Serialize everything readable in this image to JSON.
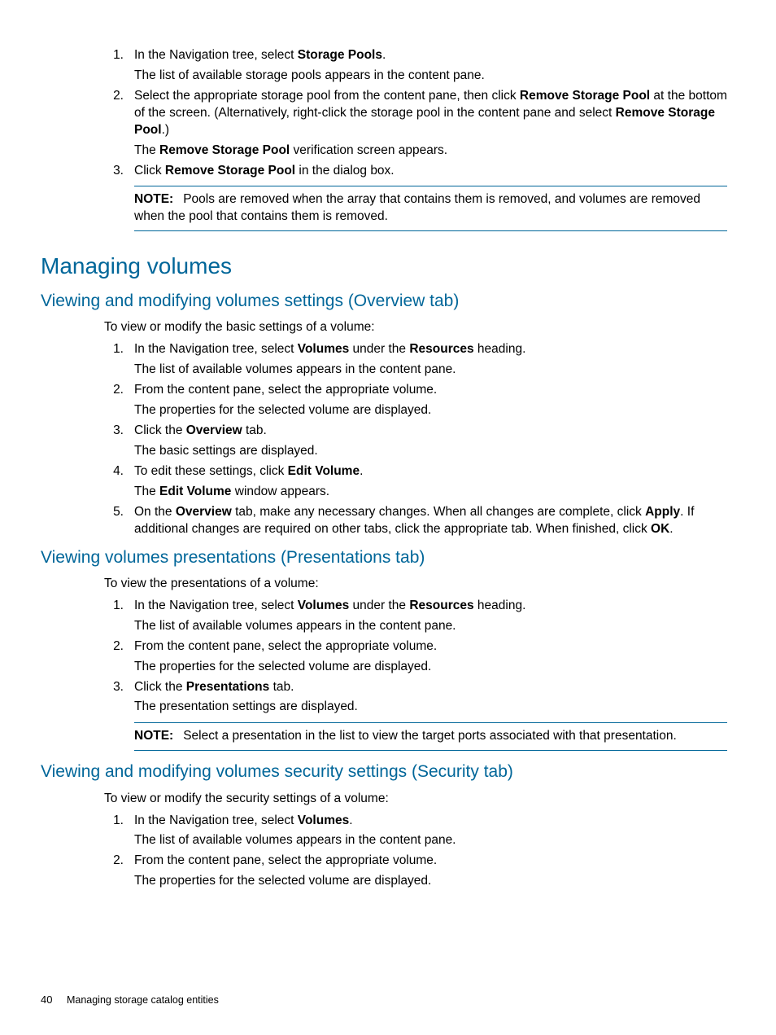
{
  "topList": {
    "items": [
      {
        "num": "1.",
        "line": "In the Navigation tree, select ",
        "bold1": "Storage Pools",
        "after1": ".",
        "result": "The list of available storage pools appears in the content pane."
      },
      {
        "num": "2.",
        "line": "Select the appropriate storage pool from the content pane, then click ",
        "bold1": "Remove Storage Pool",
        "after1": " at the bottom of the screen. (Alternatively, right-click the storage pool in the content pane and select ",
        "bold2": "Remove Storage Pool",
        "after2": ".)",
        "resultPre": "The ",
        "resultBold": "Remove Storage Pool",
        "resultPost": " verification screen appears."
      },
      {
        "num": "3.",
        "line": "Click ",
        "bold1": "Remove Storage Pool",
        "after1": " in the dialog box."
      }
    ],
    "note": {
      "label": "NOTE:",
      "text": "Pools are removed when the array that contains them is removed, and volumes are removed when the pool that contains them is removed."
    }
  },
  "h1": "Managing volumes",
  "sections": [
    {
      "heading": "Viewing and modifying volumes settings (Overview tab)",
      "intro": "To view or modify the basic settings of a volume:",
      "items": [
        {
          "num": "1.",
          "line": "In the Navigation tree, select ",
          "bold1": "Volumes",
          "after1": " under the ",
          "bold2": "Resources",
          "after2": " heading.",
          "result": "The list of available volumes appears in the content pane."
        },
        {
          "num": "2.",
          "line": "From the content pane, select the appropriate volume.",
          "result": "The properties for the selected volume are displayed."
        },
        {
          "num": "3.",
          "line": "Click the ",
          "bold1": "Overview",
          "after1": " tab.",
          "result": "The basic settings are displayed."
        },
        {
          "num": "4.",
          "line": "To edit these settings, click ",
          "bold1": "Edit Volume",
          "after1": ".",
          "resultPre": "The ",
          "resultBold": "Edit Volume",
          "resultPost": " window appears."
        },
        {
          "num": "5.",
          "line": "On the ",
          "bold1": "Overview",
          "after1": " tab, make any necessary changes. When all changes are complete, click ",
          "bold2": "Apply",
          "after2": ". If additional changes are required on other tabs, click the appropriate tab. When finished, click ",
          "bold3": "OK",
          "after3": "."
        }
      ]
    },
    {
      "heading": "Viewing volumes presentations (Presentations tab)",
      "intro": "To view the presentations of a volume:",
      "items": [
        {
          "num": "1.",
          "line": "In the Navigation tree, select ",
          "bold1": "Volumes",
          "after1": " under the ",
          "bold2": "Resources",
          "after2": " heading.",
          "result": "The list of available volumes appears in the content pane."
        },
        {
          "num": "2.",
          "line": "From the content pane, select the appropriate volume.",
          "result": "The properties for the selected volume are displayed."
        },
        {
          "num": "3.",
          "line": "Click the ",
          "bold1": "Presentations",
          "after1": " tab.",
          "result": "The presentation settings are displayed."
        }
      ],
      "note": {
        "label": "NOTE:",
        "text": "Select a presentation in the list to view the target ports associated with that presentation."
      }
    },
    {
      "heading": "Viewing and modifying volumes security settings (Security tab)",
      "intro": "To view or modify the security settings of a volume:",
      "items": [
        {
          "num": "1.",
          "line": "In the Navigation tree, select ",
          "bold1": "Volumes",
          "after1": ".",
          "result": "The list of available volumes appears in the content pane."
        },
        {
          "num": "2.",
          "line": "From the content pane, select the appropriate volume.",
          "result": "The properties for the selected volume are displayed."
        }
      ]
    }
  ],
  "footer": {
    "page": "40",
    "title": "Managing storage catalog entities"
  }
}
